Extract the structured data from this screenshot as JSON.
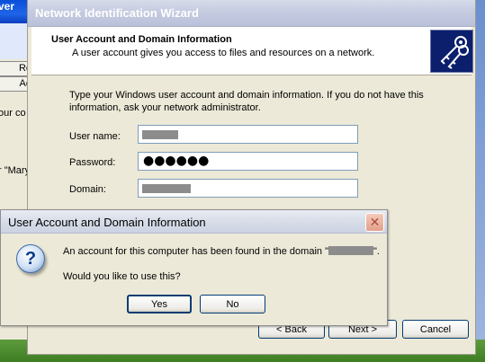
{
  "background_window": {
    "title_fragment": "ver",
    "tab_1": "Re",
    "tab_2": "Ad",
    "text_1": "our co",
    "text_2": "r \"Mary"
  },
  "wizard": {
    "title": "Network Identification Wizard",
    "header_title": "User Account and Domain Information",
    "header_subtitle": "A user account gives you access to files and resources on a network.",
    "header_icon": "keys-icon",
    "intro_text": "Type your Windows user account and domain information. If you do not have this information, ask your network administrator.",
    "username_label": "User name:",
    "password_label": "Password:",
    "password_value": "●●●●●●",
    "domain_label": "Domain:",
    "back_label": "< Back",
    "next_label": "Next >",
    "cancel_label": "Cancel"
  },
  "message_box": {
    "title": "User Account and Domain Information",
    "close_label": "✕",
    "icon": "question-icon",
    "line_1_prefix": "An account for this computer has been found in the domain \"",
    "line_1_suffix": "\".",
    "line_2": "Would you like to use this?",
    "yes_label": "Yes",
    "no_label": "No"
  },
  "colors": {
    "dialog_face": "#ece9d8",
    "button_border": "#003c74",
    "wizard_icon_bg": "#0b1f6d"
  }
}
